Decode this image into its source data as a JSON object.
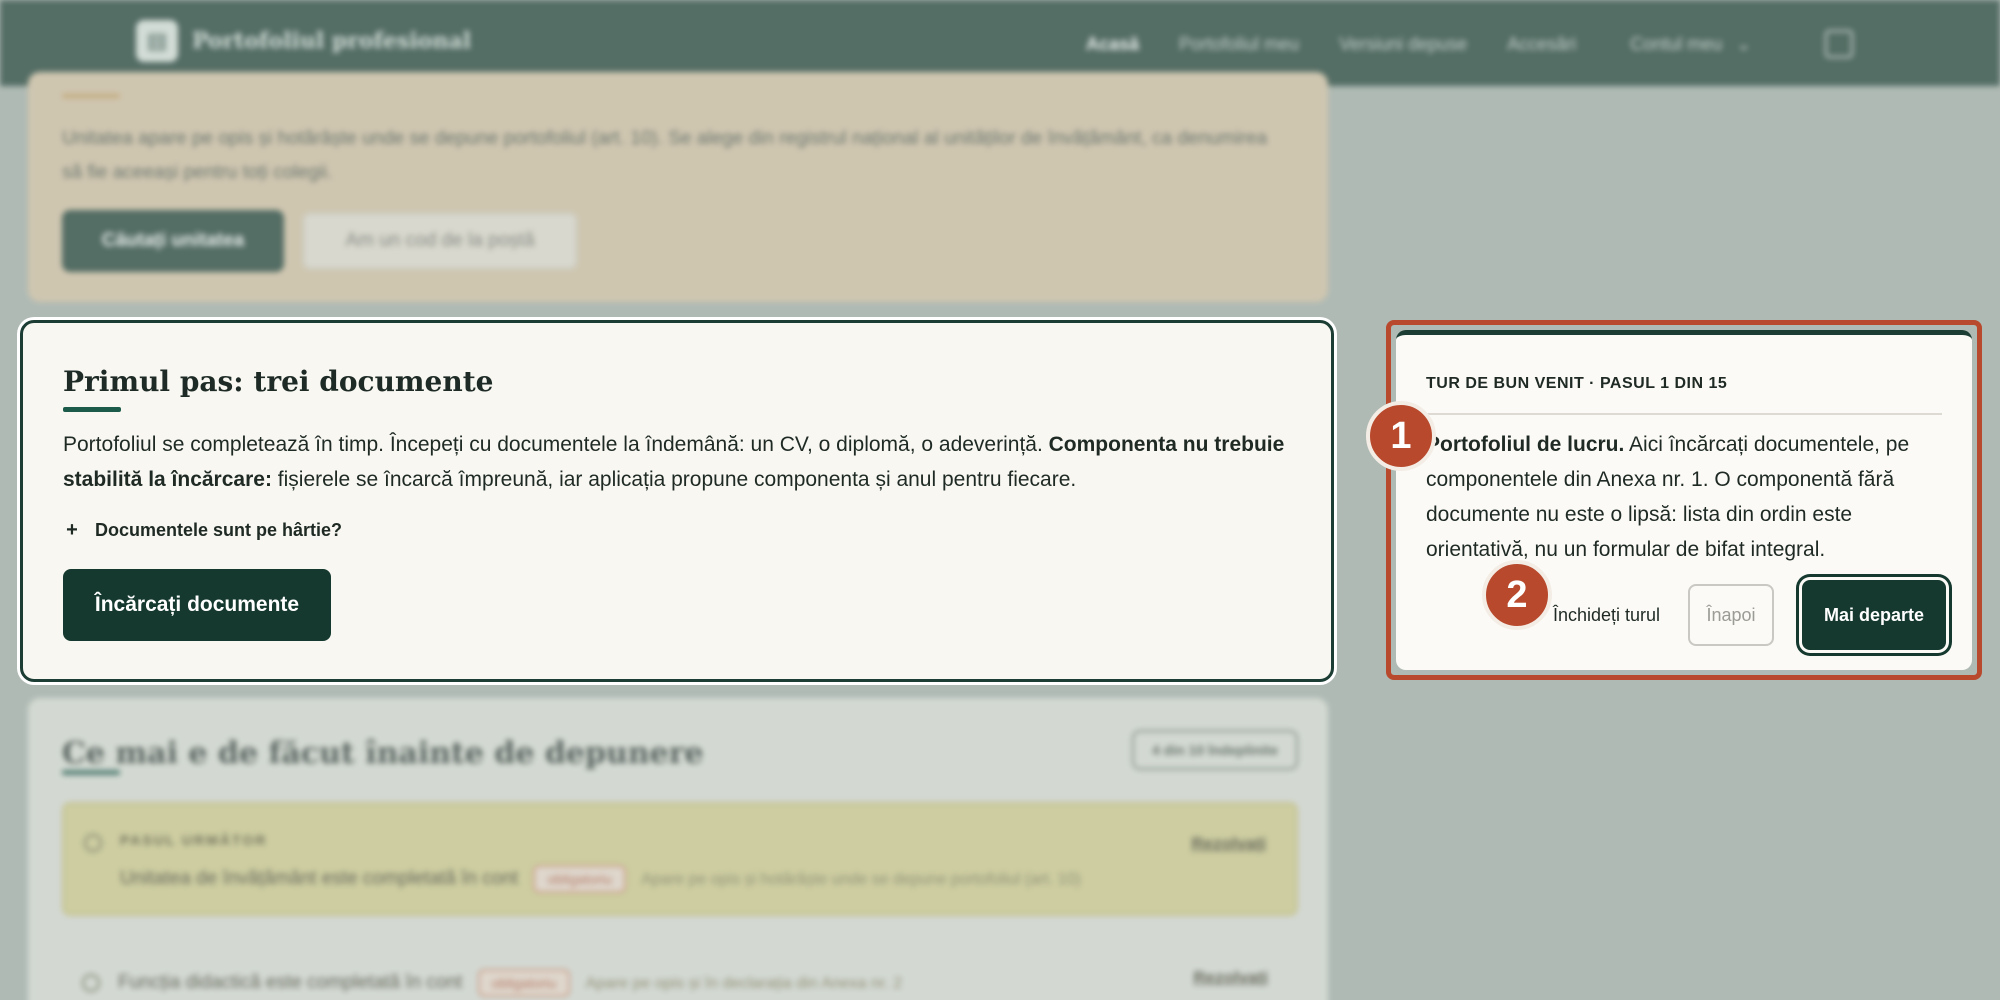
{
  "topbar": {
    "brand_title": "Portofoliul profesional",
    "nav": {
      "home": "Acasă",
      "portfolio": "Portofoliul meu",
      "submitted": "Versiuni depuse",
      "access": "Accesări",
      "account": "Contul meu"
    },
    "icons": {
      "logo": "document-icon",
      "chevron": "chevron-down-icon",
      "logout": "logout-icon"
    }
  },
  "unit_card": {
    "text": "Unitatea apare pe opis și hotărâște unde se depune portofoliul (art. 10). Se alege din registrul național al unităților de învățământ, ca denumirea să fie aceeași pentru toți colegii.",
    "primary_button": "Căutați unitatea",
    "secondary_button": "Am un cod de la poștă"
  },
  "first_step_card": {
    "title": "Primul pas: trei documente",
    "body_plain": "Portofoliul se completează în timp. Începeți cu documentele la îndemână: un CV, o diplomă, o adeverință. ",
    "body_bold": "Componenta nu trebuie stabilită la încărcare:",
    "body_rest": " fișierele se încarcă împreună, iar aplicația propune componenta și anul pentru fiecare.",
    "toggle_symbol": "+",
    "toggle_label": "Documentele sunt pe hârtie?",
    "cta_button": "Încărcați documente"
  },
  "todo_card": {
    "title": "Ce mai e de făcut înainte de depunere",
    "progress_badge": "4 din 10 îndeplinite",
    "next_item": {
      "kicker": "PASUL URMĂTOR",
      "text": "Unitatea de învățământ este completată în cont",
      "tag": "obligatoriu",
      "note": "Apare pe opis și hotărăște unde se depune portofoliul (art. 10)",
      "link": "Rezolvați"
    },
    "second_item": {
      "text": "Funcția didactică este completată în cont",
      "tag": "obligatoriu",
      "note": "Apare pe opis și în declarația din Anexa nr. 2",
      "link": "Rezolvați"
    }
  },
  "tour": {
    "kicker": "TUR DE BUN VENIT · PASUL 1 DIN 15",
    "body_bold": "Portofoliul de lucru.",
    "body_rest": " Aici încărcați documentele, pe componentele din Anexa nr. 1. O componentă fără documente nu este o lipsă: lista din ordin este orientativă, nu un formular de bifat integral.",
    "close_link": "Închideți turul",
    "back_button": "Înapoi",
    "next_button": "Mai departe"
  },
  "markers": {
    "one": "1",
    "two": "2"
  },
  "colors": {
    "brand_dark": "#1c3d33",
    "highlight_outline": "#b8492c",
    "marker": "#b8492c",
    "unit_card_bg": "#d9c5a6",
    "next_item_bg": "#d6cf8f"
  }
}
